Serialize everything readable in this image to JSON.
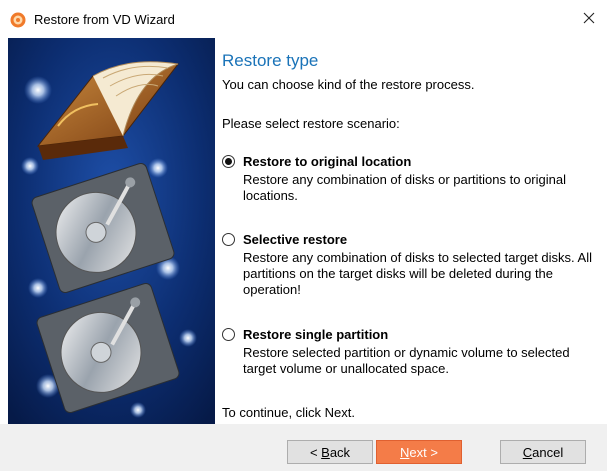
{
  "window": {
    "title": "Restore from VD Wizard",
    "close_glyph": "✕",
    "app_icon": "app-logo-icon"
  },
  "page": {
    "heading": "Restore type",
    "subheading": "You can choose kind of the restore process.",
    "prompt": "Please select restore scenario:",
    "footer": "To continue, click Next."
  },
  "options": [
    {
      "label": "Restore to original location",
      "description": "Restore any combination of disks or partitions to original locations.",
      "selected": true
    },
    {
      "label": "Selective restore",
      "description": "Restore any combination of disks to selected target disks. All partitions on the target disks will be deleted during the operation!",
      "selected": false
    },
    {
      "label": "Restore single partition",
      "description": "Restore selected partition or dynamic volume to selected target volume or unallocated space.",
      "selected": false
    }
  ],
  "buttons": {
    "back_prefix": "< ",
    "back_mnemonic": "B",
    "back_rest": "ack",
    "next_mnemonic": "N",
    "next_rest": "ext >",
    "cancel_mnemonic": "C",
    "cancel_rest": "ancel"
  },
  "colors": {
    "heading": "#1a73b8",
    "primary_button": "#f47c48",
    "side_panel_bg": "#0b2a66"
  }
}
